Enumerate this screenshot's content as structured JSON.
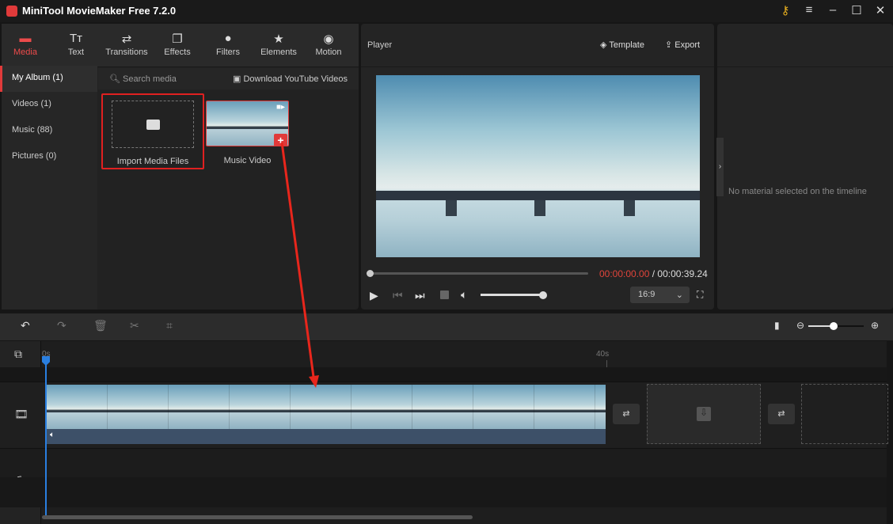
{
  "app": {
    "title": "MiniTool MovieMaker Free 7.2.0"
  },
  "window_controls": [
    "key-icon",
    "menu-icon",
    "minimize-icon",
    "maximize-icon",
    "close-icon"
  ],
  "toolbar": [
    {
      "label": "Media",
      "icon": "folder-icon",
      "active": true
    },
    {
      "label": "Text",
      "icon": "text-icon"
    },
    {
      "label": "Transitions",
      "icon": "transitions-icon"
    },
    {
      "label": "Effects",
      "icon": "effects-icon"
    },
    {
      "label": "Filters",
      "icon": "filters-icon"
    },
    {
      "label": "Elements",
      "icon": "elements-icon"
    },
    {
      "label": "Motion",
      "icon": "motion-icon"
    }
  ],
  "sidebar": [
    {
      "label": "My Album (1)",
      "active": true
    },
    {
      "label": "Videos (1)"
    },
    {
      "label": "Music (88)"
    },
    {
      "label": "Pictures (0)"
    }
  ],
  "media": {
    "search_placeholder": "Search media",
    "download_label": "Download YouTube Videos",
    "import_label": "Import Media Files",
    "clip_label": "Music Video"
  },
  "player": {
    "title": "Player",
    "template_label": "Template",
    "export_label": "Export",
    "current_time": "00:00:00.00",
    "total_time": "/ 00:00:39.24",
    "aspect": "16:9",
    "volume": 1.0,
    "progress": 0
  },
  "properties": {
    "empty_text": "No material selected on the timeline"
  },
  "timeline": {
    "ruler": [
      "0s",
      "40s"
    ],
    "zoom_level": 0.45
  },
  "colors": {
    "accent": "#e03a3a",
    "playhead": "#2a7fe0"
  }
}
